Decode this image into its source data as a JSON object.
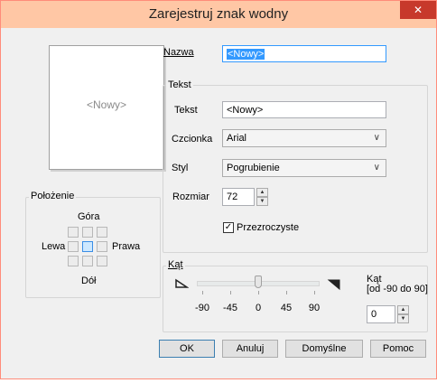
{
  "window": {
    "title": "Zarejestruj znak wodny",
    "close_glyph": "✕"
  },
  "preview": {
    "text": "<Nowy>"
  },
  "name": {
    "label": "Nazwa",
    "value": "<Nowy>"
  },
  "text_group": {
    "title": "Tekst",
    "text_label": "Tekst",
    "text_value": "<Nowy>",
    "font_label": "Czcionka",
    "font_value": "Arial",
    "style_label": "Styl",
    "style_value": "Pogrubienie",
    "size_label": "Rozmiar",
    "size_value": "72",
    "transparent_label": "Przezroczyste",
    "transparent_checked": true
  },
  "position_group": {
    "title": "Położenie",
    "top": "Góra",
    "left": "Lewa",
    "right": "Prawa",
    "bottom": "Dół",
    "selected": "center"
  },
  "angle_group": {
    "title": "Kąt",
    "ticks": [
      "-90",
      "-45",
      "0",
      "45",
      "90"
    ],
    "slider_value": 0,
    "slider_min": -90,
    "slider_max": 90,
    "field_label_line1": "Kąt",
    "field_label_line2": "[od -90 do 90]",
    "field_value": "0"
  },
  "buttons": {
    "ok": "OK",
    "cancel": "Anuluj",
    "default": "Domyślne",
    "help": "Pomoc"
  },
  "icons": {
    "close": "close-icon",
    "spin_up": "spin-up-icon",
    "spin_down": "spin-down-icon",
    "dropdown": "chevron-down-icon",
    "angle_left": "angle-left-icon",
    "angle_right": "angle-right-icon"
  }
}
